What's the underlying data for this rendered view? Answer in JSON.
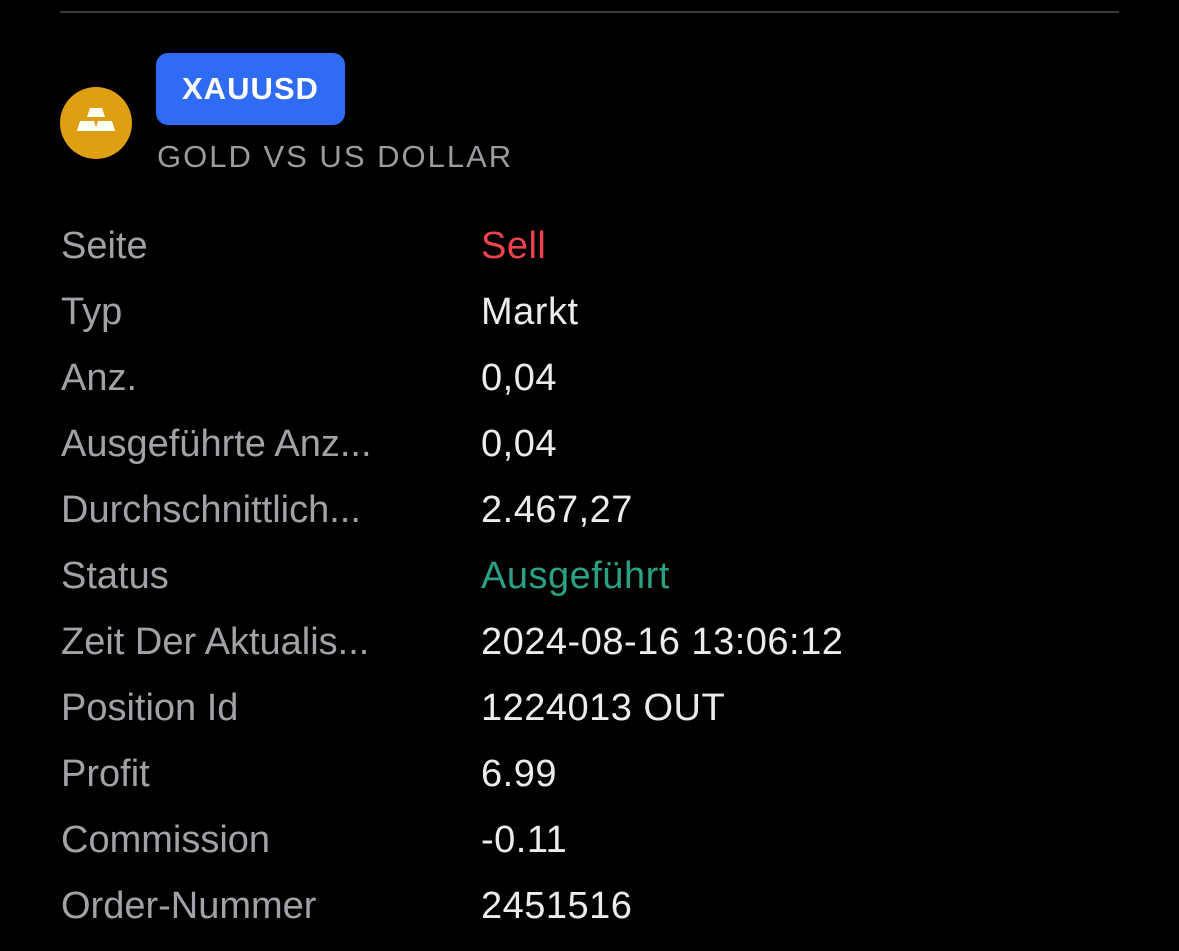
{
  "instrument": {
    "icon": "gold-bars-icon",
    "icon_color": "#dea012",
    "symbol": "XAUUSD",
    "symbol_badge_color": "#2f6bf5",
    "description": "GOLD VS US DOLLAR"
  },
  "details": {
    "side": {
      "label": "Seite",
      "value": "Sell",
      "color": "#f0424e"
    },
    "type": {
      "label": "Typ",
      "value": "Markt"
    },
    "quantity": {
      "label": "Anz.",
      "value": "0,04"
    },
    "executed_quantity": {
      "label": "Ausgeführte Anz...",
      "value": "0,04"
    },
    "average_price": {
      "label": "Durchschnittlich...",
      "value": "2.467,27"
    },
    "status": {
      "label": "Status",
      "value": "Ausgeführt",
      "color": "#2aa185"
    },
    "update_time": {
      "label": "Zeit Der Aktualis...",
      "value": "2024-08-16 13:06:12"
    },
    "position_id": {
      "label": "Position Id",
      "value": "1224013 OUT"
    },
    "profit": {
      "label": "Profit",
      "value": "6.99"
    },
    "commission": {
      "label": "Commission",
      "value": "-0.11"
    },
    "order_number": {
      "label": "Order-Nummer",
      "value": "2451516"
    }
  }
}
